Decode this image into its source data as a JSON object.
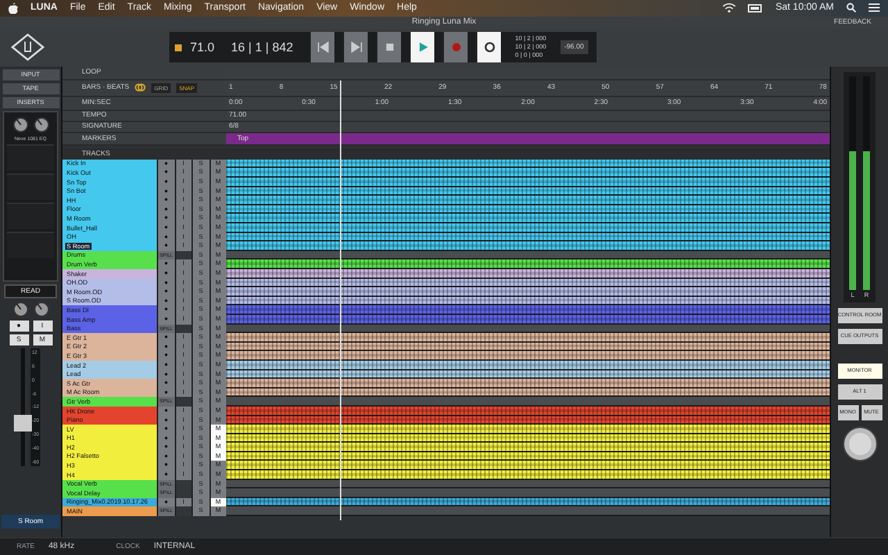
{
  "menu_bar": {
    "app": "LUNA",
    "items": [
      "File",
      "Edit",
      "Track",
      "Mixing",
      "Transport",
      "Navigation",
      "View",
      "Window",
      "Help"
    ],
    "clock": "Sat 10:00 AM"
  },
  "title_bar": {
    "title": "Ringing Luna Mix",
    "feedback": "FEEDBACK"
  },
  "transport": {
    "tempo": "71.0",
    "position": "16 | 1 | 842",
    "buttons": [
      {
        "kind": "rewind",
        "selected": false
      },
      {
        "kind": "forward",
        "selected": false
      },
      {
        "kind": "stop",
        "selected": false
      },
      {
        "kind": "play",
        "selected": true
      },
      {
        "kind": "record",
        "selected": false
      },
      {
        "kind": "loop",
        "selected": true
      }
    ],
    "counters": [
      "10 | 2 | 000",
      "10 | 2 | 000",
      "0 | 0 | 000"
    ],
    "readout": "-96.00"
  },
  "channel_strip": {
    "tabs": [
      {
        "label": "INPUT",
        "selected": false
      },
      {
        "label": "TAPE",
        "selected": false
      },
      {
        "label": "INSERTS",
        "selected": false
      }
    ],
    "plugin": "Neve 1081 EQ",
    "automation": "READ",
    "buttons": [
      "●",
      "I",
      "S",
      "M"
    ],
    "scale": [
      "12",
      "6",
      "0",
      "-6",
      "-12",
      "-20",
      "-30",
      "-40",
      "-60"
    ],
    "name": "S Room"
  },
  "ruler": {
    "loop": "LOOP",
    "bars": "BARS · BEATS",
    "grid": "GRID",
    "snap": "SNAP",
    "minsec": "MIN:SEC",
    "tempo": "TEMPO",
    "signature": "SIGNATURE",
    "markers": "MARKERS",
    "bar_ticks": [
      "1",
      "8",
      "15",
      "22",
      "29",
      "36",
      "43",
      "50",
      "57",
      "64",
      "71",
      "78"
    ],
    "time_ticks": [
      "0:00",
      "0:30",
      "1:00",
      "1:30",
      "2:00",
      "2:30",
      "3:00",
      "3:30",
      "4:00"
    ],
    "tempo_value": "71.00",
    "signature_value": "6/8",
    "marker": "Top"
  },
  "tracks_header": "TRACKS",
  "tracks": [
    {
      "name": "Kick In",
      "color": "#44c8ee",
      "kind": "audio",
      "selected": false,
      "muted": false,
      "buttons": [
        "●",
        "I",
        "S",
        "M"
      ]
    },
    {
      "name": "Kick Out",
      "color": "#44c8ee",
      "kind": "audio",
      "selected": false,
      "muted": false,
      "buttons": [
        "●",
        "I",
        "S",
        "M"
      ]
    },
    {
      "name": "Sn Top",
      "color": "#44c8ee",
      "kind": "audio",
      "selected": false,
      "muted": false,
      "buttons": [
        "●",
        "I",
        "S",
        "M"
      ]
    },
    {
      "name": "Sn Bot",
      "color": "#44c8ee",
      "kind": "audio",
      "selected": false,
      "muted": false,
      "buttons": [
        "●",
        "I",
        "S",
        "M"
      ]
    },
    {
      "name": "HH",
      "color": "#44c8ee",
      "kind": "audio",
      "selected": false,
      "muted": false,
      "buttons": [
        "●",
        "I",
        "S",
        "M"
      ]
    },
    {
      "name": "Floor",
      "color": "#44c8ee",
      "kind": "audio",
      "selected": false,
      "muted": false,
      "buttons": [
        "●",
        "I",
        "S",
        "M"
      ]
    },
    {
      "name": "M Room",
      "color": "#44c8ee",
      "kind": "audio",
      "selected": false,
      "muted": false,
      "buttons": [
        "●",
        "I",
        "S",
        "M"
      ]
    },
    {
      "name": "Bullet_Hall",
      "color": "#44c8ee",
      "kind": "audio",
      "selected": false,
      "muted": false,
      "buttons": [
        "●",
        "I",
        "S",
        "M"
      ]
    },
    {
      "name": "OH",
      "color": "#44c8ee",
      "kind": "audio",
      "selected": false,
      "muted": false,
      "buttons": [
        "●",
        "I",
        "S",
        "M"
      ]
    },
    {
      "name": "S Room",
      "color": "#44c8ee",
      "kind": "audio",
      "selected": true,
      "muted": false,
      "buttons": [
        "●",
        "I",
        "S",
        "M"
      ]
    },
    {
      "name": "Drums",
      "color": "#58e04c",
      "kind": "spill",
      "selected": false,
      "muted": false,
      "buttons": [
        "SPILL",
        "S",
        "M"
      ]
    },
    {
      "name": "Drum Verb",
      "color": "#58e04c",
      "kind": "audio",
      "selected": false,
      "muted": false,
      "buttons": [
        "●",
        "I",
        "S",
        "M"
      ]
    },
    {
      "name": "Shaker",
      "color": "#c8b4dc",
      "kind": "audio",
      "selected": false,
      "muted": false,
      "buttons": [
        "●",
        "I",
        "S",
        "M"
      ]
    },
    {
      "name": "OH.OD",
      "color": "#b4bce8",
      "kind": "audio",
      "selected": false,
      "muted": false,
      "buttons": [
        "●",
        "I",
        "S",
        "M"
      ]
    },
    {
      "name": "M Room.OD",
      "color": "#b4bce8",
      "kind": "audio",
      "selected": false,
      "muted": false,
      "buttons": [
        "●",
        "I",
        "S",
        "M"
      ]
    },
    {
      "name": "S Room.OD",
      "color": "#b4bce8",
      "kind": "audio",
      "selected": false,
      "muted": false,
      "buttons": [
        "●",
        "I",
        "S",
        "M"
      ]
    },
    {
      "name": "Bass DI",
      "color": "#5c62e6",
      "kind": "audio",
      "selected": false,
      "muted": false,
      "buttons": [
        "●",
        "I",
        "S",
        "M"
      ]
    },
    {
      "name": "Bass Amp",
      "color": "#5c62e6",
      "kind": "audio",
      "selected": false,
      "muted": false,
      "buttons": [
        "●",
        "I",
        "S",
        "M"
      ]
    },
    {
      "name": "Bass",
      "color": "#5c62e6",
      "kind": "spill",
      "selected": false,
      "muted": false,
      "buttons": [
        "SPILL",
        "S",
        "M"
      ]
    },
    {
      "name": "E Gtr 1",
      "color": "#dcb49c",
      "kind": "audio",
      "selected": false,
      "muted": false,
      "buttons": [
        "●",
        "I",
        "S",
        "M"
      ]
    },
    {
      "name": "E Gtr 2",
      "color": "#dcb49c",
      "kind": "audio",
      "selected": false,
      "muted": false,
      "buttons": [
        "●",
        "I",
        "S",
        "M"
      ]
    },
    {
      "name": "E Gtr 3",
      "color": "#dcb49c",
      "kind": "audio",
      "selected": false,
      "muted": false,
      "buttons": [
        "●",
        "I",
        "S",
        "M"
      ]
    },
    {
      "name": "Lead 2",
      "color": "#a4cce6",
      "kind": "audio",
      "selected": false,
      "muted": false,
      "buttons": [
        "●",
        "I",
        "S",
        "M"
      ]
    },
    {
      "name": "Lead",
      "color": "#a4cce6",
      "kind": "audio",
      "selected": false,
      "muted": false,
      "buttons": [
        "●",
        "I",
        "S",
        "M"
      ]
    },
    {
      "name": "S Ac Gtr",
      "color": "#dcb49c",
      "kind": "audio",
      "selected": false,
      "muted": false,
      "buttons": [
        "●",
        "I",
        "S",
        "M"
      ]
    },
    {
      "name": "M Ac Room",
      "color": "#dcb49c",
      "kind": "audio",
      "selected": false,
      "muted": false,
      "buttons": [
        "●",
        "I",
        "S",
        "M"
      ]
    },
    {
      "name": "Gtr Verb",
      "color": "#58e04c",
      "kind": "spill",
      "selected": false,
      "muted": false,
      "buttons": [
        "SPILL",
        "S",
        "M"
      ]
    },
    {
      "name": "HK Drone",
      "color": "#e4442e",
      "kind": "audio",
      "selected": false,
      "muted": false,
      "buttons": [
        "●",
        "I",
        "S",
        "M"
      ]
    },
    {
      "name": "Piano",
      "color": "#e4442e",
      "kind": "audio",
      "selected": false,
      "muted": false,
      "buttons": [
        "●",
        "I",
        "S",
        "M"
      ]
    },
    {
      "name": "LV",
      "color": "#f2ee3e",
      "kind": "audio",
      "selected": false,
      "muted": true,
      "buttons": [
        "●",
        "I",
        "S",
        "M"
      ]
    },
    {
      "name": "H1",
      "color": "#f2ee3e",
      "kind": "audio",
      "selected": false,
      "muted": true,
      "buttons": [
        "●",
        "I",
        "S",
        "M"
      ]
    },
    {
      "name": "H2",
      "color": "#f2ee3e",
      "kind": "audio",
      "selected": false,
      "muted": true,
      "buttons": [
        "●",
        "I",
        "S",
        "M"
      ]
    },
    {
      "name": "H2 Falsetto",
      "color": "#f2ee3e",
      "kind": "audio",
      "selected": false,
      "muted": true,
      "buttons": [
        "●",
        "I",
        "S",
        "M"
      ]
    },
    {
      "name": "H3",
      "color": "#f2ee3e",
      "kind": "audio",
      "selected": false,
      "muted": false,
      "buttons": [
        "●",
        "I",
        "S",
        "M"
      ]
    },
    {
      "name": "H4",
      "color": "#f2ee3e",
      "kind": "audio",
      "selected": false,
      "muted": false,
      "buttons": [
        "●",
        "I",
        "S",
        "M"
      ]
    },
    {
      "name": "Vocal Verb",
      "color": "#58e04c",
      "kind": "spill",
      "selected": false,
      "muted": false,
      "buttons": [
        "SPILL",
        "S",
        "M"
      ]
    },
    {
      "name": "Vocal Delay",
      "color": "#58e04c",
      "kind": "spill",
      "selected": false,
      "muted": false,
      "buttons": [
        "SPILL",
        "S",
        "M"
      ]
    },
    {
      "name": "Ringing_Mix0.2019.10.17.26",
      "color": "#3caada",
      "kind": "audio",
      "selected": false,
      "muted": true,
      "buttons": [
        "●",
        "I",
        "S",
        "M"
      ]
    },
    {
      "name": "MAIN",
      "color": "#ec9c4c",
      "kind": "spill",
      "selected": false,
      "muted": false,
      "buttons": [
        "SPILL",
        "S",
        "M"
      ]
    }
  ],
  "monitor": {
    "meter_labels": [
      "L",
      "R"
    ],
    "buttons": [
      {
        "label": "CONTROL ROOM",
        "selected": false
      },
      {
        "label": "CUE OUTPUTS",
        "selected": false
      },
      {
        "label": "MONITOR",
        "selected": true
      },
      {
        "label": "ALT 1",
        "selected": false
      },
      {
        "label": "MONO",
        "selected": false
      },
      {
        "label": "MUTE",
        "selected": false
      }
    ]
  },
  "status_bar": {
    "rate_label": "RATE",
    "rate": "48 kHz",
    "clock_label": "CLOCK",
    "clock": "INTERNAL"
  }
}
